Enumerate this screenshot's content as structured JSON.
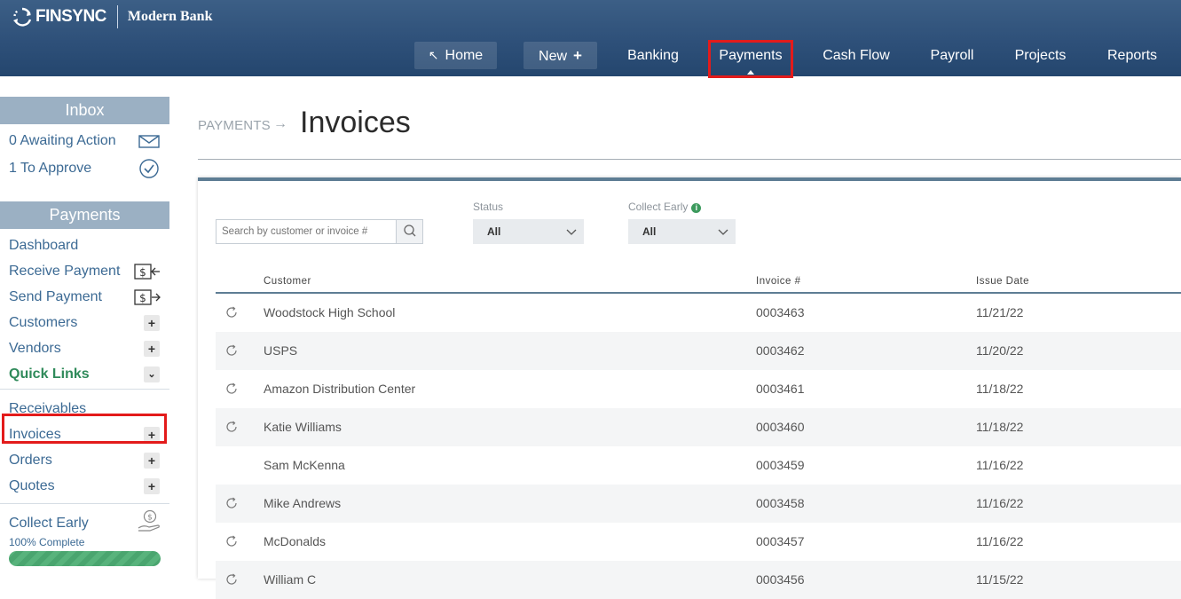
{
  "brand": {
    "logo_text": "FINSYNC",
    "bank_name": "Modern Bank"
  },
  "nav": {
    "home": "Home",
    "new": "New",
    "banking": "Banking",
    "payments": "Payments",
    "cashflow": "Cash Flow",
    "payroll": "Payroll",
    "projects": "Projects",
    "reports": "Reports"
  },
  "sidebar": {
    "inbox_header": "Inbox",
    "awaiting": "0 Awaiting Action",
    "to_approve": "1 To Approve",
    "payments_header": "Payments",
    "dashboard": "Dashboard",
    "receive_payment": "Receive Payment",
    "send_payment": "Send Payment",
    "customers": "Customers",
    "vendors": "Vendors",
    "quick_links": "Quick Links",
    "receivables": "Receivables",
    "invoices": "Invoices",
    "orders": "Orders",
    "quotes": "Quotes",
    "collect_early": "Collect Early",
    "progress_label": "100% Complete",
    "progress_value": 1.0
  },
  "main": {
    "breadcrumb": "PAYMENTS",
    "title": "Invoices",
    "search_placeholder": "Search by customer or invoice #",
    "status_label": "Status",
    "status_value": "All",
    "collect_early_label": "Collect Early",
    "collect_early_value": "All",
    "columns": {
      "customer": "Customer",
      "invoice": "Invoice #",
      "issue_date": "Issue Date"
    },
    "rows": [
      {
        "customer": "Woodstock High School",
        "invoice": "0003463",
        "date": "11/21/22",
        "recurring": true
      },
      {
        "customer": "USPS",
        "invoice": "0003462",
        "date": "11/20/22",
        "recurring": true
      },
      {
        "customer": "Amazon Distribution Center",
        "invoice": "0003461",
        "date": "11/18/22",
        "recurring": true
      },
      {
        "customer": "Katie Williams",
        "invoice": "0003460",
        "date": "11/18/22",
        "recurring": true
      },
      {
        "customer": "Sam McKenna",
        "invoice": "0003459",
        "date": "11/16/22",
        "recurring": false
      },
      {
        "customer": "Mike Andrews",
        "invoice": "0003458",
        "date": "11/16/22",
        "recurring": true
      },
      {
        "customer": "McDonalds",
        "invoice": "0003457",
        "date": "11/16/22",
        "recurring": true
      },
      {
        "customer": "William C",
        "invoice": "0003456",
        "date": "11/15/22",
        "recurring": true
      }
    ]
  },
  "colors": {
    "accent_green": "#2f8a5a",
    "link_blue": "#3c6a94",
    "highlight_red": "#e31b1b",
    "header_blue": "#2e5079"
  }
}
